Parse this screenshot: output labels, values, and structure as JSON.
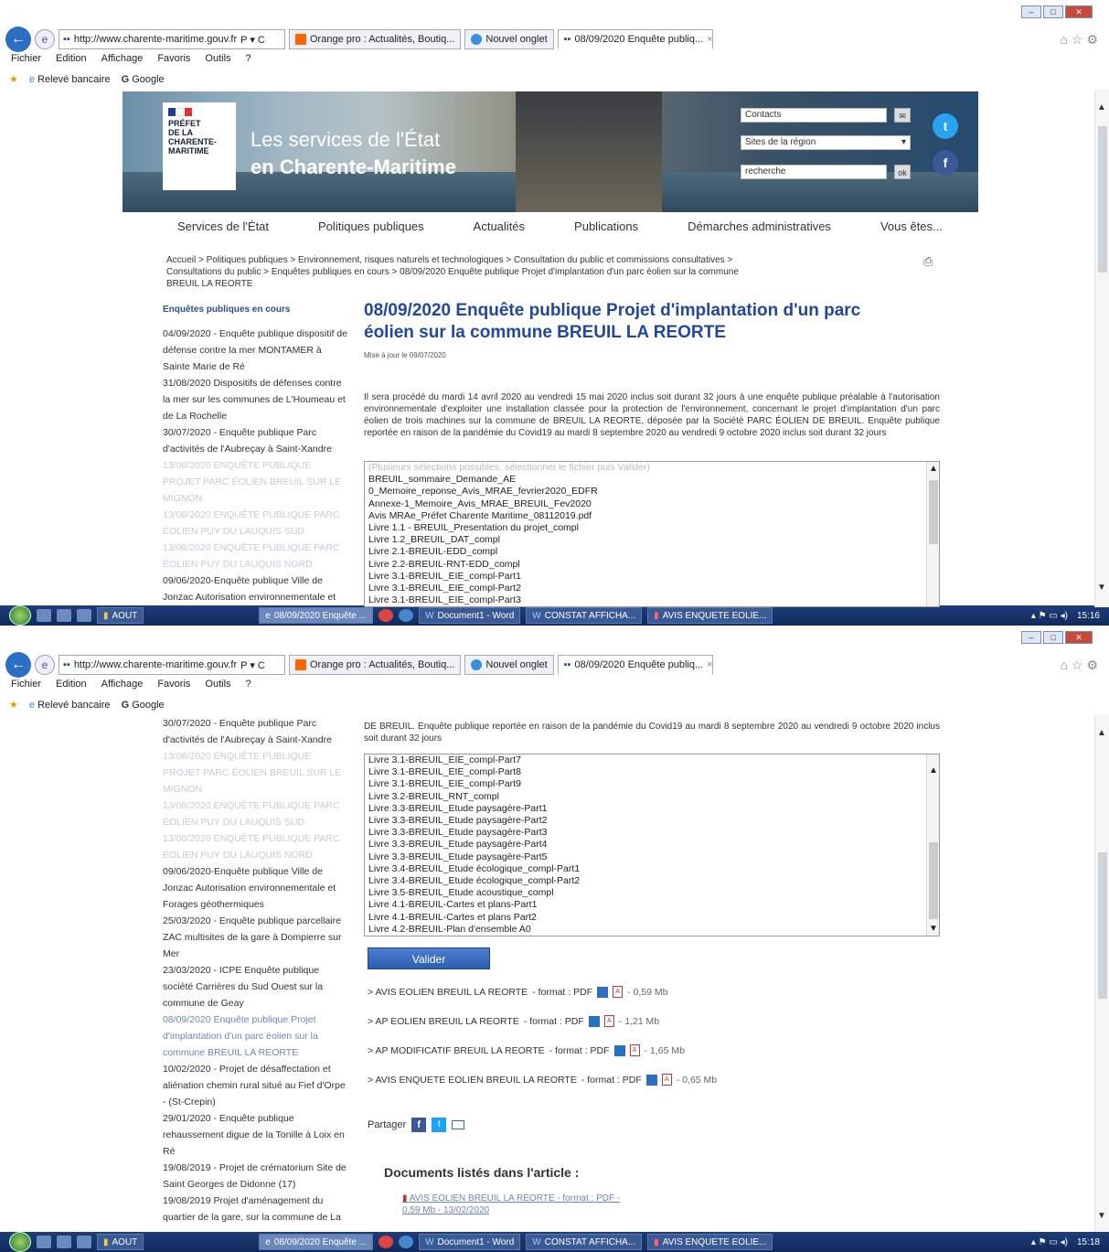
{
  "browser": {
    "url": "http://www.charente-maritime.gouv.fr",
    "url_suffix": "P ▾ C",
    "tabs": [
      "Orange pro : Actualités, Boutiq...",
      "Nouvel onglet",
      "08/09/2020 Enquête publiq...",
      "×"
    ],
    "menu": [
      "Fichier",
      "Edition",
      "Affichage",
      "Favoris",
      "Outils",
      "?"
    ],
    "favorites": [
      "Relevé bancaire",
      "Google"
    ]
  },
  "header": {
    "logo_lines": [
      "PRÉFET",
      "DE LA",
      "CHARENTE-",
      "MARITIME"
    ],
    "title_line1": "Les services de l'État",
    "title_line2": "en Charente-Maritime",
    "contacts": "Contacts",
    "sites": "Sites de la région",
    "search_placeholder": "recherche",
    "ok": "ok"
  },
  "nav": [
    "Services de l'État",
    "Politiques publiques",
    "Actualités",
    "Publications",
    "Démarches administratives",
    "Vous êtes..."
  ],
  "breadcrumb": "Accueil > Politiques publiques > Environnement, risques naturels et technologiques > Consultation du public et commissions consultatives > Consultations du public > Enquêtes publiques en cours > 08/09/2020 Enquête publique Projet d'implantation d'un parc éolien sur la commune BREUIL LA REORTE",
  "sidebar": {
    "heading": "Enquêtes publiques en cours",
    "items1": [
      {
        "t": "04/09/2020 - Enquête publique dispositif de défense contre la mer MONTAMER à Sainte Marie de Ré",
        "s": "n"
      },
      {
        "t": "31/08/2020 Dispositifs de défenses contre la mer sur les communes de L'Houmeau et de La Rochelle",
        "s": "n"
      },
      {
        "t": "30/07/2020 - Enquête publique Parc d'activités de l'Aubreçay à Saint-Xandre",
        "s": "n"
      },
      {
        "t": "13/08/2020 ENQUÊTE PUBLIQUE PROJET PARC ÉOLIEN BREUIL SUR LE MIGNON",
        "s": "f"
      },
      {
        "t": "13/08/2020 ENQUÊTE PUBLIQUE PARC ÉOLIEN PUY DU LAUQUIS SUD",
        "s": "f"
      },
      {
        "t": "13/08/2020 ENQUÊTE PUBLIQUE PARC ÉOLIEN PUY DU LAUQUIS NORD",
        "s": "f"
      },
      {
        "t": "09/06/2020-Enquête publique Ville de Jonzac Autorisation environnementale et",
        "s": "n"
      }
    ],
    "items2": [
      {
        "t": "30/07/2020 - Enquête publique Parc d'activités de l'Aubreçay à Saint-Xandre",
        "s": "n"
      },
      {
        "t": "13/08/2020 ENQUÊTE PUBLIQUE PROJET PARC ÉOLIEN BREUIL SUR LE MIGNON",
        "s": "f"
      },
      {
        "t": "13/08/2020 ENQUÊTE PUBLIQUE PARC ÉOLIEN PUY DU LAUQUIS SUD",
        "s": "f"
      },
      {
        "t": "13/08/2020 ENQUÊTE PUBLIQUE PARC ÉOLIEN PUY DU LAUQUIS NORD",
        "s": "f"
      },
      {
        "t": "09/06/2020-Enquête publique Ville de Jonzac Autorisation environnementale et Forages géothermiques",
        "s": "n"
      },
      {
        "t": "25/03/2020 - Enquête publique parcellaire ZAC multisites de la gare à Dompierre sur Mer",
        "s": "n"
      },
      {
        "t": "23/03/2020 - ICPE Enquête publique société Carrières du Sud Ouest sur la commune de Geay",
        "s": "n"
      },
      {
        "t": "08/09/2020 Enquête publique Projet d'implantation d'un parc éolien sur la commune BREUIL LA REORTE",
        "s": "a"
      },
      {
        "t": "10/02/2020 - Projet de désaffectation et aliénation chemin rural situé au Fief d'Orpe - (St-Crepin)",
        "s": "n"
      },
      {
        "t": "29/01/2020 - Enquête publique rehaussement digue de la Tonille à Loix en Ré",
        "s": "n"
      },
      {
        "t": "19/08/2019 - Projet de crématorium Site de Saint Georges de Didonne (17)",
        "s": "n"
      },
      {
        "t": "19/08/2019 Projet d'aménagement du quartier de la gare, sur la commune de La",
        "s": "n"
      }
    ]
  },
  "article": {
    "title": "08/09/2020 Enquête publique Projet d'implantation d'un parc éolien sur la commune BREUIL LA REORTE",
    "meta": "Mise à jour le 09/07/2020",
    "body": "Il sera procédé du mardi 14 avril 2020 au vendredi 15 mai 2020 inclus soit durant 32 jours à une enquête publique préalable à l'autorisation environnementale d'exploiter une installation classée pour la protection de l'environnement, concernant le projet d'implantation d'un parc éolien de trois machines sur la commune de BREUIL LA REORTE, déposée par la Société PARC ÉOLIEN DE BREUIL. Enquête publique reportée en raison de la pandémie du Covid19 au mardi 8 septembre 2020 au vendredi 9 octobre 2020 inclus soit durant 32 jours",
    "body_tail": "DE BREUIL. Enquête publique reportée en raison de la pandémie du Covid19 au mardi 8 septembre 2020 au vendredi 9 octobre 2020 inclus soit durant 32 jours",
    "list_hint": "(Plusieurs sélections possibles, sélectionner le fichier puis Valider)",
    "list1": [
      "BREUIL_sommaire_Demande_AE",
      "0_Memoire_reponse_Avis_MRAE_fevrier2020_EDFR",
      "Annexe-1_Memoire_Avis_MRAE_BREUIL_Fev2020",
      "Avis MRAe_Préfet Charente Maritime_08112019.pdf",
      "Livre 1.1 - BREUIL_Presentation du projet_compl",
      "Livre 1.2_BREUIL_DAT_compl",
      "Livre 2.1-BREUIL-EDD_compl",
      "Livre 2.2-BREUIL-RNT-EDD_compl",
      "Livre 3.1-BREUIL_EIE_compl-Part1",
      "Livre 3.1-BREUIL_EIE_compl-Part2",
      "Livre 3.1-BREUIL_EIE_compl-Part3"
    ],
    "list2": [
      "Livre 3.1-BREUIL_EIE_compl-Part7",
      "Livre 3.1-BREUIL_EIE_compl-Part8",
      "Livre 3.1-BREUIL_EIE_compl-Part9",
      "Livre 3.2-BREUIL_RNT_compl",
      "Livre 3.3-BREUIL_Etude paysagère-Part1",
      "Livre 3.3-BREUIL_Etude paysagère-Part2",
      "Livre 3.3-BREUIL_Etude paysagère-Part3",
      "Livre 3.3-BREUIL_Etude paysagère-Part4",
      "Livre 3.3-BREUIL_Etude paysagère-Part5",
      "Livre 3.4-BREUIL_Etude écologique_compl-Part1",
      "Livre 3.4-BREUIL_Etude écologique_compl-Part2",
      "Livre 3.5-BREUIL_Etude acoustique_compl",
      "Livre 4.1-BREUIL-Cartes et plans-Part1",
      "Livre 4.1-BREUIL-Cartes et plans Part2",
      "Livre 4.2-BREUIL-Plan d'ensemble A0"
    ],
    "valider": "Valider",
    "downloads": [
      {
        "name": "> AVIS EOLIEN BREUIL LA REORTE",
        "fmt": "- format : PDF",
        "size": "- 0,59 Mb"
      },
      {
        "name": "> AP EOLIEN BREUIL LA REORTE",
        "fmt": "- format : PDF",
        "size": "- 1,21 Mb"
      },
      {
        "name": "> AP MODIFICATIF BREUIL LA REORTE",
        "fmt": "- format : PDF",
        "size": "- 1,65 Mb"
      },
      {
        "name": "> AVIS ENQUETE EOLIEN BREUIL LA REORTE",
        "fmt": "- format : PDF",
        "size": "- 0,65 Mb"
      }
    ],
    "share": "Partager",
    "docs_heading": "Documents listés dans l'article :",
    "doc_link": "AVIS EOLIEN BREUIL LA REORTE - format : PDF - 0,59 Mb - 13/02/2020"
  },
  "taskbar": {
    "buttons": [
      "AOUT",
      "08/09/2020 Enquête ...",
      "Document1 - Word",
      "CONSTAT AFFICHA...",
      "AVIS ENQUETE EOLIE..."
    ],
    "time1": "15:16",
    "time2": "15:18"
  }
}
